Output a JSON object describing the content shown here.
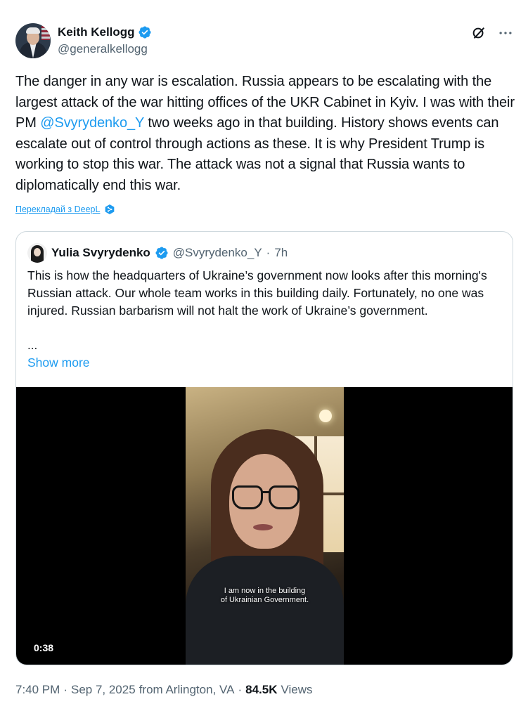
{
  "author": {
    "name": "Keith Kellogg",
    "handle": "@generalkellogg",
    "verified_icon": "verified-badge-icon",
    "avatar_icon": "avatar"
  },
  "top_actions": {
    "grok_icon": "grok-icon",
    "more_icon": "more-icon"
  },
  "tweet": {
    "text_before": "The danger in any war is escalation. Russia appears to be escalating with the largest attack of the war hitting offices of the UKR Cabinet in Kyiv. I was with their PM ",
    "mention": "@Svyrydenko_Y",
    "text_after": " two weeks ago in that building. History shows events can escalate out of control through actions as these. It is why President Trump is working to stop this war. The attack was not a signal that Russia wants to diplomatically end this war."
  },
  "translate": {
    "label": "Перекладай з DeepL",
    "icon": "deepl-icon"
  },
  "quote": {
    "name": "Yulia Svyrydenko",
    "handle": "@Svyrydenko_Y",
    "separator": "·",
    "time": "7h",
    "text": "This is how the headquarters of Ukraine’s government now looks after this morning's Russian attack. Our whole team works in this building daily. Fortunately, no one was injured. Russian barbarism will not halt the work of Ukraine’s government.",
    "ellipsis": "...",
    "show_more": "Show more",
    "video": {
      "caption_line1": "I am now in the building",
      "caption_line2": "of Ukrainian Government.",
      "duration": "0:38"
    }
  },
  "meta": {
    "time": "7:40 PM",
    "sep1": "·",
    "date": "Sep 7, 2025",
    "location": "from Arlington, VA",
    "sep2": "·",
    "views_count": "84.5K",
    "views_label": "Views"
  },
  "colors": {
    "link": "#1d9bf0",
    "text": "#0f1419",
    "secondary": "#536471",
    "border": "#cfd9de"
  }
}
